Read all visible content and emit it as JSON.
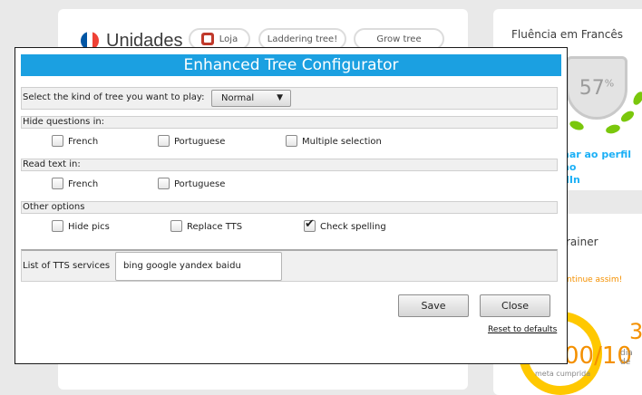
{
  "background": {
    "units_title": "Unidades",
    "pills": [
      "Loja",
      "Laddering tree!",
      "Grow tree"
    ],
    "fluency": {
      "title": "Fluência em Francês",
      "percent": "57",
      "percent_sign": "%",
      "link_line1": "nar ao perfil no",
      "link_line2": "dIn"
    },
    "trainer": {
      "title": "rainer",
      "note": "ntinue assim!",
      "ring_value": "00/10",
      "ring_sub": "meta cumprida",
      "streak_value": "3",
      "streak_label": "dia de"
    },
    "colors": {
      "flag_blue": "#0055a4",
      "flag_white": "#ffffff",
      "flag_red": "#ef4135",
      "accent": "#1cb0f6",
      "orange": "#f49000"
    }
  },
  "dialog": {
    "title": "Enhanced Tree Configurator",
    "title_bg": "#1ba0e1",
    "tree_kind": {
      "label": "Select the kind of tree you want to play:",
      "selected": "Normal"
    },
    "hide_questions": {
      "label": "Hide questions in:",
      "options": [
        {
          "label": "French",
          "checked": false
        },
        {
          "label": "Portuguese",
          "checked": false
        },
        {
          "label": "Multiple selection",
          "checked": false
        }
      ]
    },
    "read_text": {
      "label": "Read text in:",
      "options": [
        {
          "label": "French",
          "checked": false
        },
        {
          "label": "Portuguese",
          "checked": false
        }
      ]
    },
    "other_options": {
      "label": "Other options",
      "options": [
        {
          "label": "Hide pics",
          "checked": false
        },
        {
          "label": "Replace TTS",
          "checked": false
        },
        {
          "label": "Check spelling",
          "checked": true
        }
      ]
    },
    "tts": {
      "label": "List of TTS services",
      "value": "bing google yandex baidu"
    },
    "buttons": {
      "save": "Save",
      "close": "Close"
    },
    "reset_link": "Reset to defaults"
  }
}
